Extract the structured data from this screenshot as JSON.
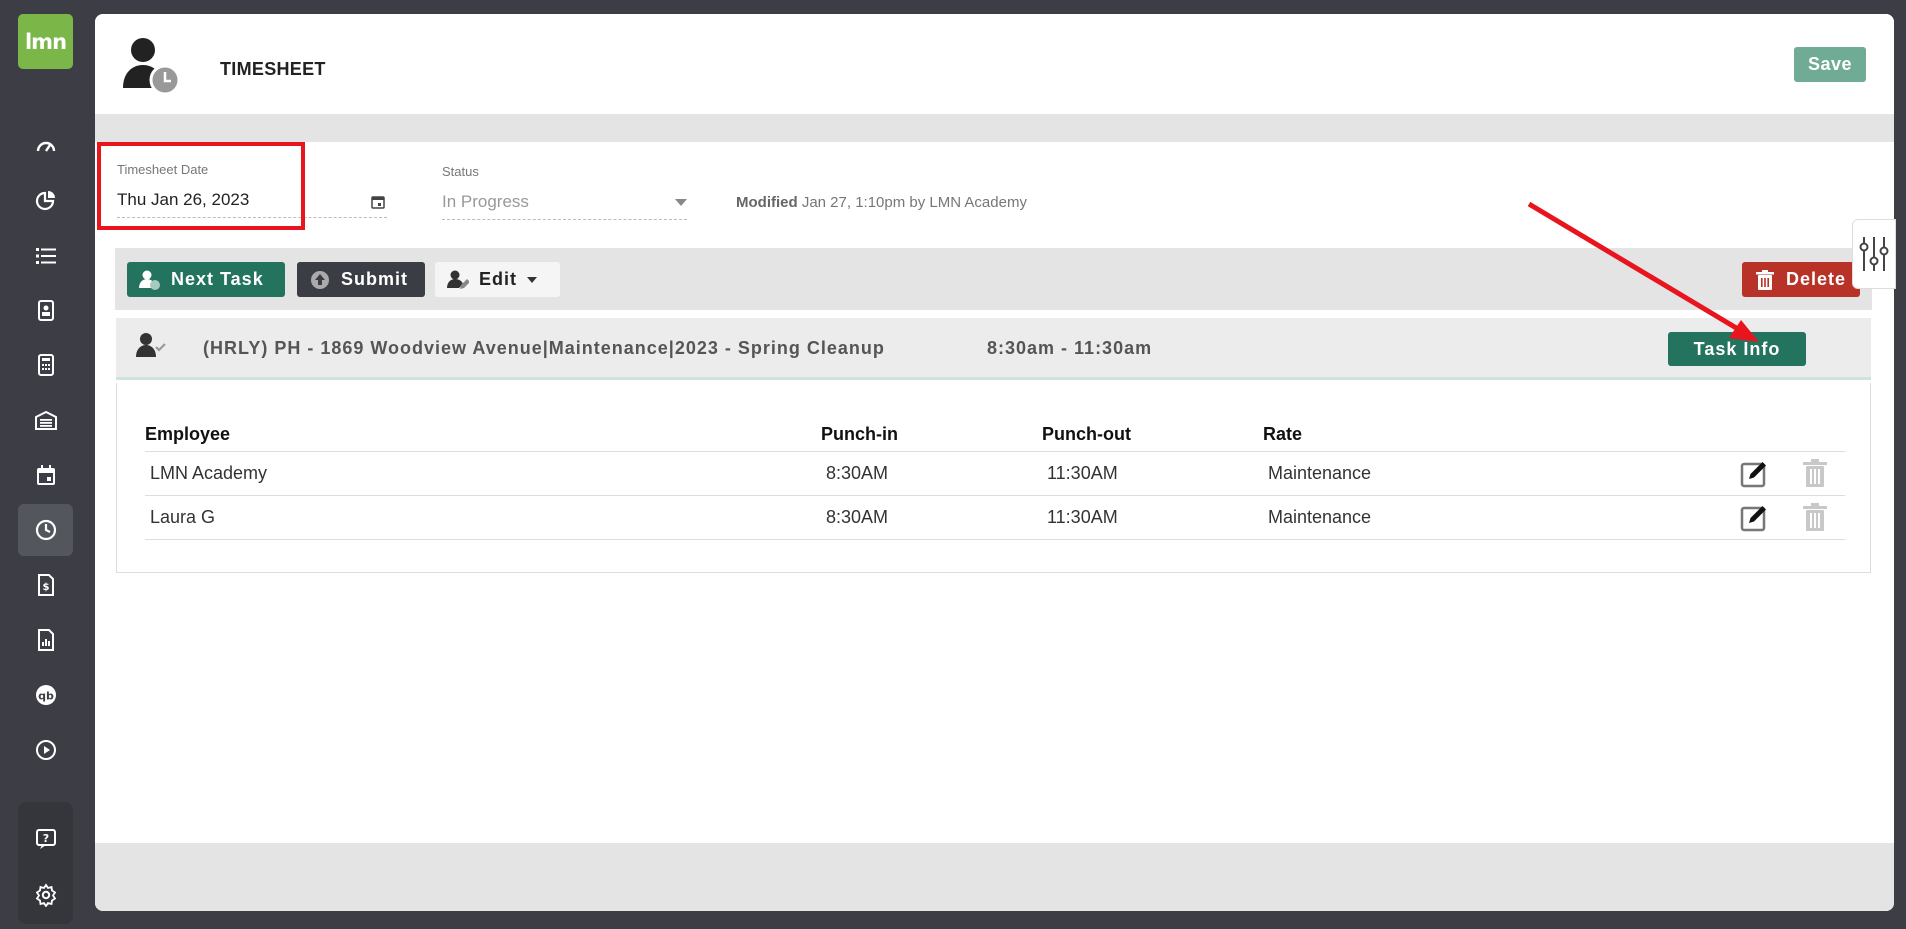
{
  "app": {
    "logo_text": "lmn",
    "brand_color": "#7ab648"
  },
  "sidebar": {
    "items": [
      {
        "icon": "gauge-icon"
      },
      {
        "icon": "pie-chart-icon"
      },
      {
        "icon": "list-icon"
      },
      {
        "icon": "clipboard-icon"
      },
      {
        "icon": "calculator-icon"
      },
      {
        "icon": "warehouse-icon"
      },
      {
        "icon": "calendar-icon"
      },
      {
        "icon": "clock-icon",
        "active": true
      },
      {
        "icon": "invoice-icon"
      },
      {
        "icon": "report-icon"
      },
      {
        "icon": "quickbooks-icon"
      },
      {
        "icon": "play-icon"
      },
      {
        "icon": "help-icon"
      },
      {
        "icon": "gear-icon"
      }
    ]
  },
  "header": {
    "title": "TIMESHEET",
    "save_label": "Save"
  },
  "form": {
    "date_label": "Timesheet Date",
    "date_value": "Thu Jan 26, 2023",
    "status_label": "Status",
    "status_value": "In Progress",
    "modified_label": "Modified",
    "modified_text": "Jan 27, 1:10pm by LMN Academy"
  },
  "toolbar": {
    "next_task": "Next Task",
    "submit": "Submit",
    "edit": "Edit",
    "delete": "Delete"
  },
  "task": {
    "title": "(HRLY) PH - 1869 Woodview Avenue|Maintenance|2023 - Spring Cleanup",
    "time": "8:30am - 11:30am",
    "info_button": "Task Info"
  },
  "employees": {
    "headers": [
      "Employee",
      "Punch-in",
      "Punch-out",
      "Rate"
    ],
    "rows": [
      {
        "name": "LMN Academy",
        "punch_in": "8:30AM",
        "punch_out": "11:30AM",
        "rate": "Maintenance"
      },
      {
        "name": "Laura G",
        "punch_in": "8:30AM",
        "punch_out": "11:30AM",
        "rate": "Maintenance"
      }
    ]
  },
  "colors": {
    "primary_green": "#23735f",
    "save_green": "#6fab95",
    "delete_red": "#b83227",
    "annotation_red": "#e8141e"
  }
}
